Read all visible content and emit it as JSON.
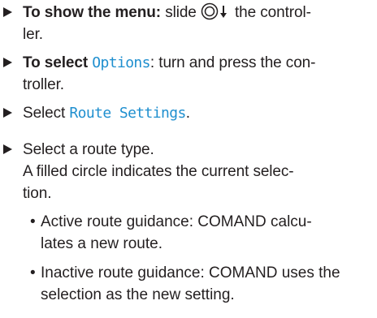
{
  "steps": [
    {
      "bold": "To show the menu:",
      "before": "slide",
      "after": "the control-ler."
    },
    {
      "bold": "To select",
      "option": "Options",
      "after": ": turn and press the con-troller."
    },
    {
      "before": "Select",
      "option": "Route Settings",
      "after": "."
    },
    {
      "text": "Select a route type.",
      "note": "A filled circle indicates the current selec-tion."
    }
  ],
  "bullets": [
    "Active route guidance: COMAND calcu-lates a new route.",
    "Inactive route guidance: COMAND uses the selection as the new setting."
  ],
  "icons": {
    "step_marker": "right-triangle-icon",
    "controller": "controller-slide-down-icon",
    "bullet": "bullet-dot"
  }
}
